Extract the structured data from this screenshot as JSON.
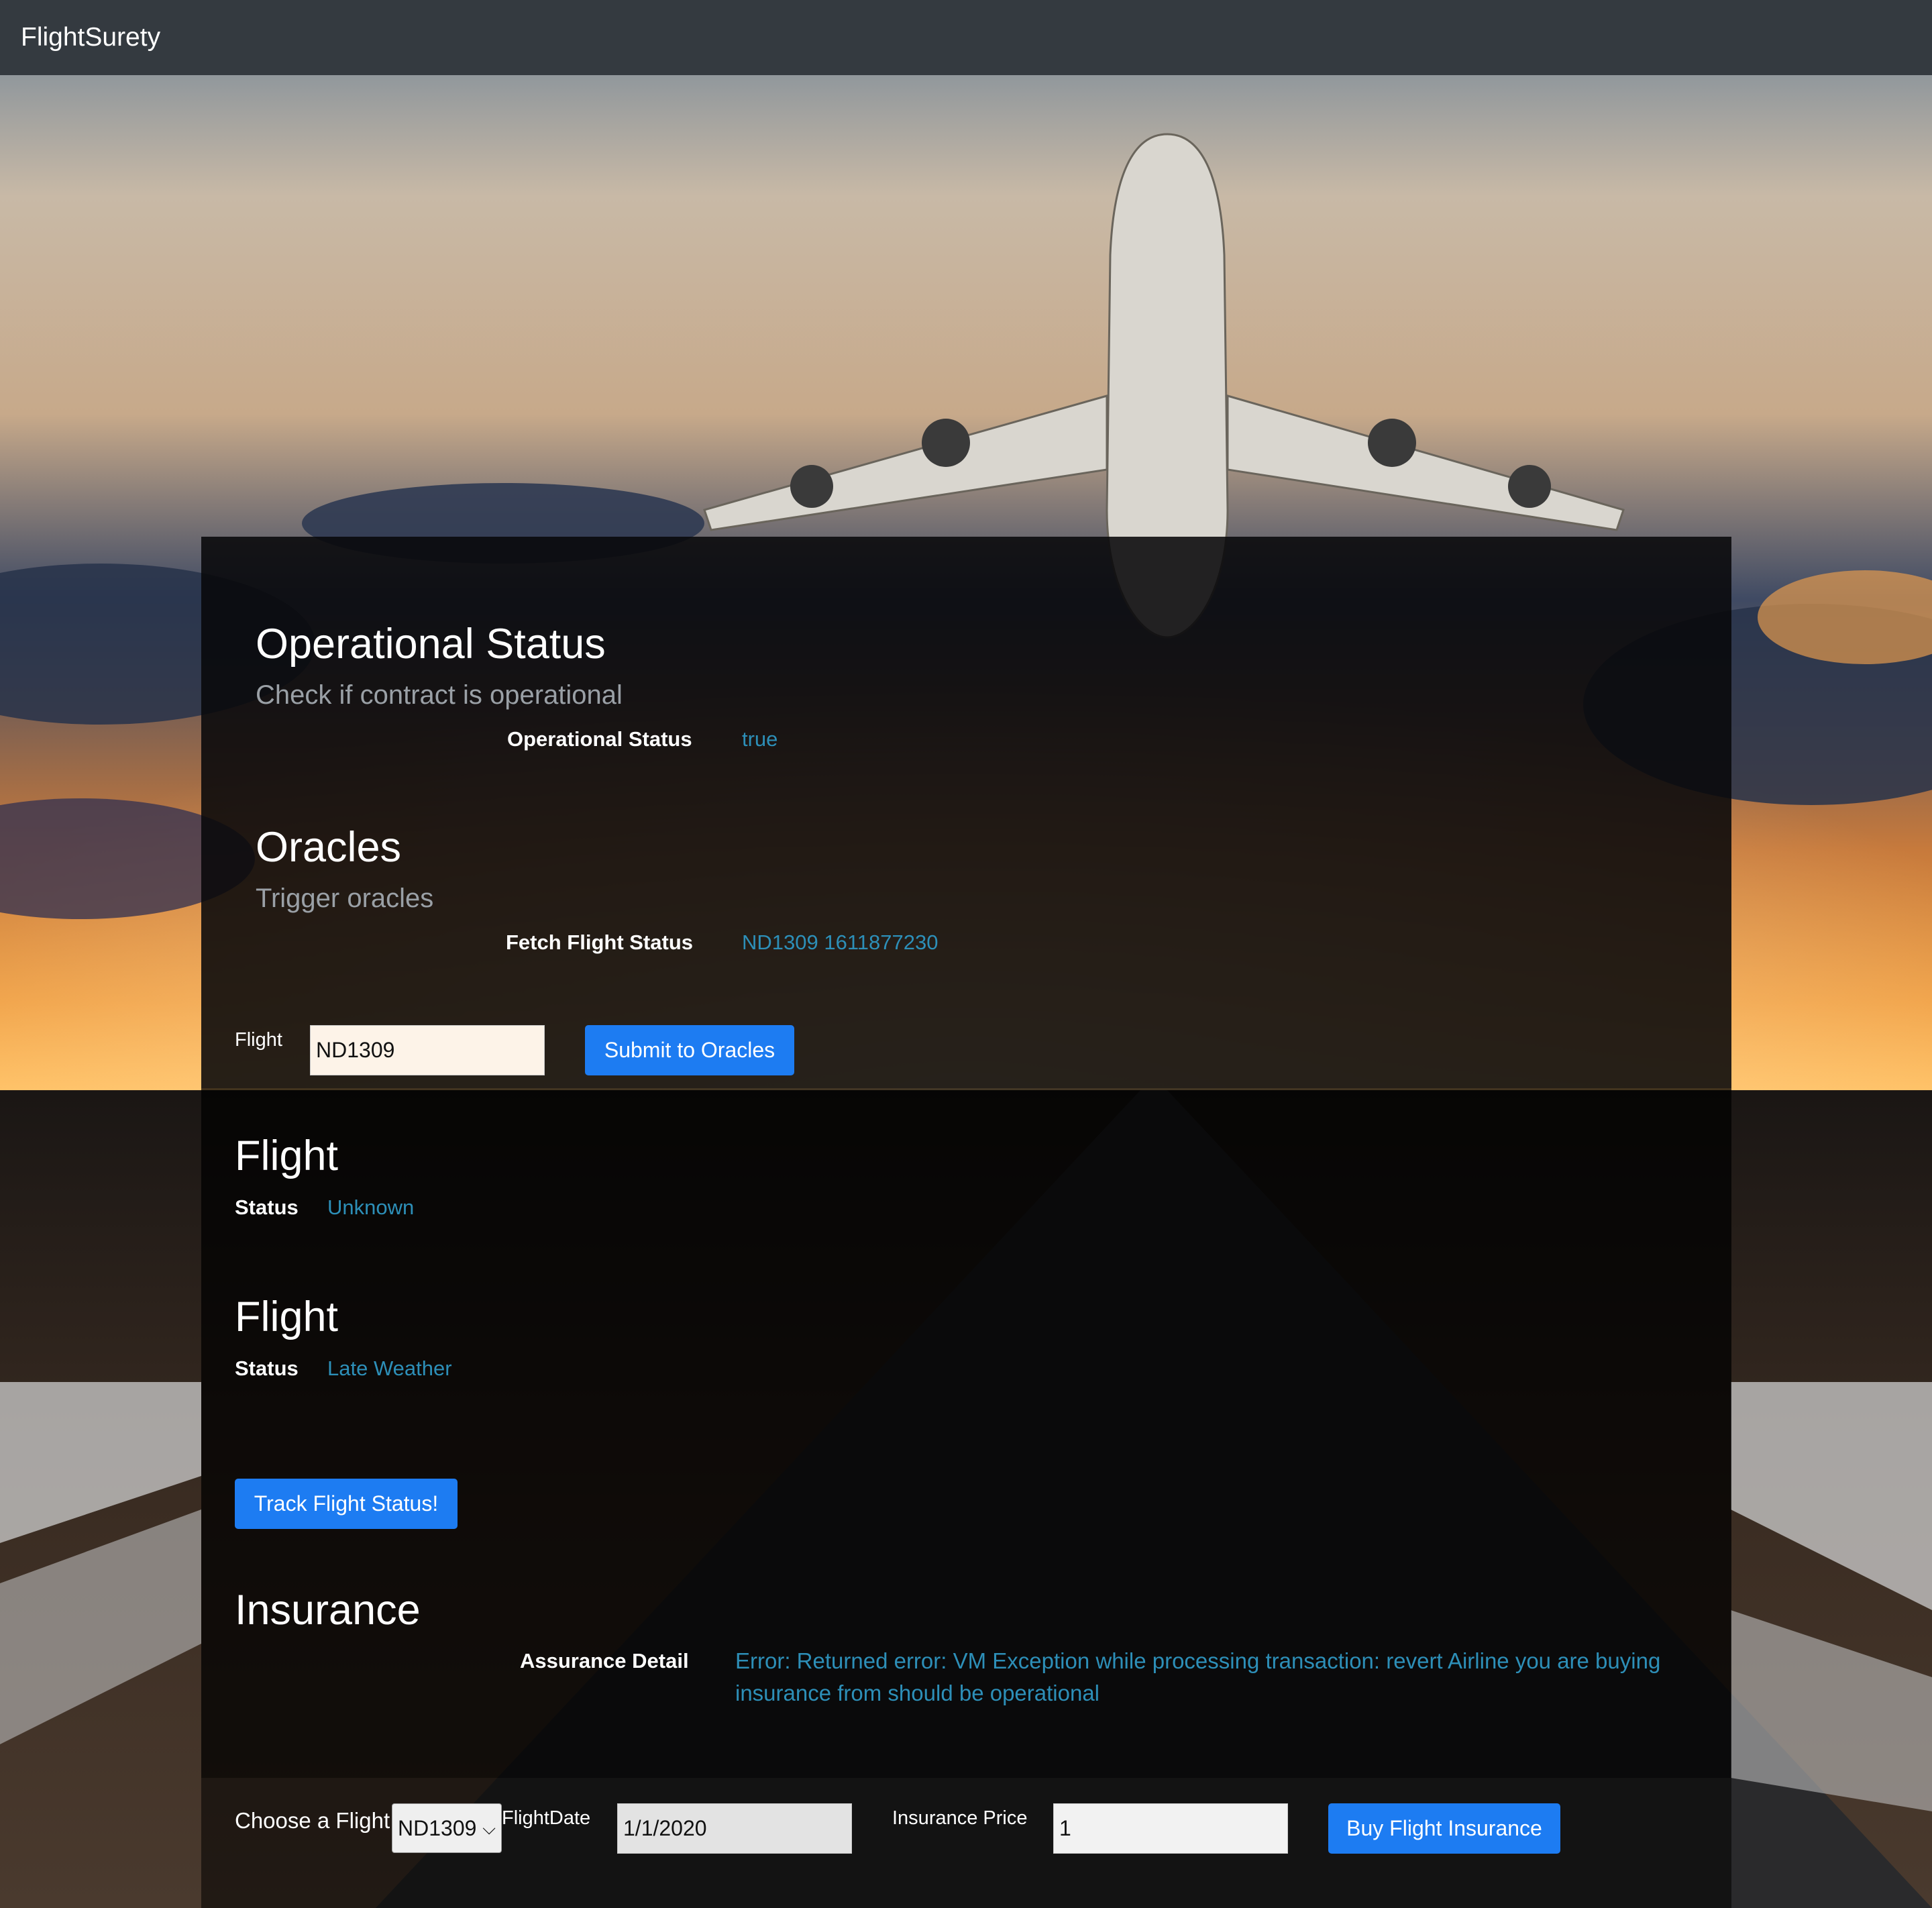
{
  "navbar": {
    "brand": "FlightSurety"
  },
  "operational": {
    "title": "Operational Status",
    "subtitle": "Check if contract is operational",
    "label": "Operational Status",
    "value": "true"
  },
  "oracles": {
    "title": "Oracles",
    "subtitle": "Trigger oracles",
    "label": "Fetch Flight Status",
    "value": "ND1309 1611877230",
    "flight_label": "Flight",
    "flight_value": "ND1309",
    "submit_label": "Submit to Oracles"
  },
  "flight_status_1": {
    "title": "Flight",
    "label": "Status",
    "value": "Unknown"
  },
  "flight_status_2": {
    "title": "Flight",
    "label": "Status",
    "value": "Late Weather"
  },
  "track": {
    "button_label": "Track Flight Status!"
  },
  "insurance": {
    "title": "Insurance",
    "detail_label": "Assurance Detail",
    "detail_value": "Error: Returned error: VM Exception while processing transaction: revert Airline you are buying insurance from should be operational",
    "choose_label": "Choose a Flight:",
    "choose_value": "ND1309",
    "date_label": "FlightDate",
    "date_value": "1/1/2020",
    "price_label": "Insurance Price",
    "price_value": "1",
    "buy_label": "Buy Flight Insurance"
  },
  "icons": {
    "select_caret": "chevron-down-icon"
  },
  "colors": {
    "accent": "#1d7cf2",
    "value_text": "#2d8fb8",
    "navbar": "#343a40"
  }
}
